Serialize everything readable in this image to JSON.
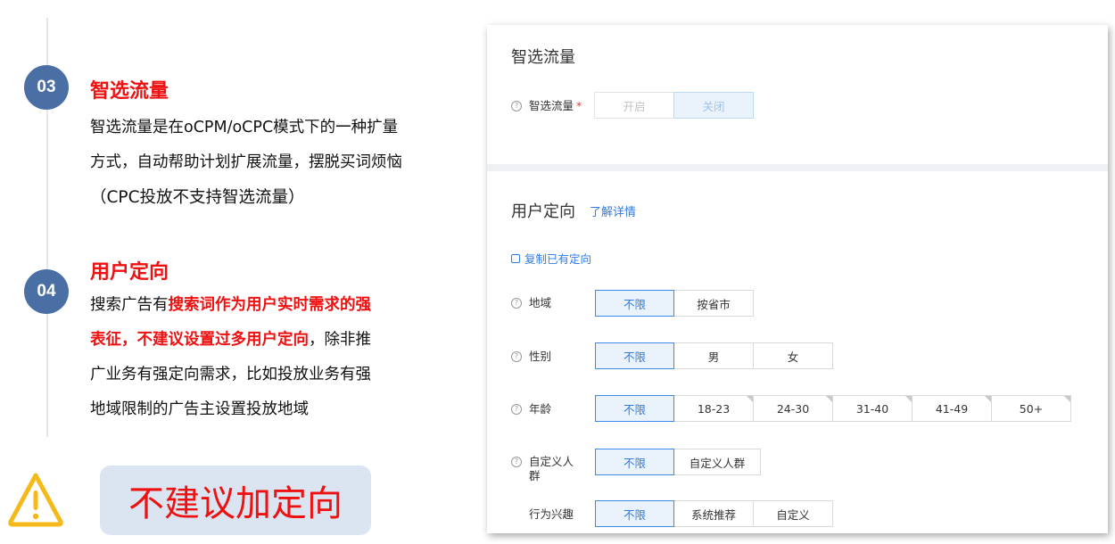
{
  "steps": [
    {
      "number": "03",
      "title": "智选流量",
      "lines": [
        "智选流量是在oCPM/oCPC模式下的一种扩量",
        "方式，自动帮助计划扩展流量，摆脱买词烦恼",
        "（CPC投放不支持智选流量）"
      ]
    },
    {
      "number": "04",
      "title": "用户定向",
      "body_prefix": "搜索广告有",
      "body_highlight_1": "搜索词作为用户实时需求的强",
      "body_highlight_2": "表征，不建议设置过多用户定向",
      "body_suffix": "，除非推",
      "lines": [
        "广业务有强定向需求，比如投放业务有强",
        "地域限制的广告主设置投放地域"
      ]
    }
  ],
  "warning": {
    "icon": "warning-triangle-icon",
    "text": "不建议加定向"
  },
  "panel": {
    "smart_traffic": {
      "title": "智选流量",
      "field_label": "智选流量",
      "required_mark": "*",
      "options": [
        "开启",
        "关闭"
      ],
      "selected": "关闭"
    },
    "user_targeting": {
      "title": "用户定向",
      "learn_more": "了解详情",
      "copy_link": "复制已有定向",
      "rows": [
        {
          "label": "地域",
          "options": [
            "不限",
            "按省市"
          ],
          "selected": "不限"
        },
        {
          "label": "性别",
          "options": [
            "不限",
            "男",
            "女"
          ],
          "selected": "不限"
        },
        {
          "label": "年龄",
          "options": [
            "不限",
            "18-23",
            "24-30",
            "31-40",
            "41-49",
            "50+"
          ],
          "selected": "不限"
        },
        {
          "label_line1": "自定义人",
          "label_line2": "群",
          "options": [
            "不限",
            "自定义人群"
          ],
          "selected": "不限"
        },
        {
          "label": "行为兴趣",
          "options": [
            "不限",
            "系统推荐",
            "自定义"
          ],
          "selected": "不限"
        }
      ]
    },
    "help_glyph": "?"
  },
  "colors": {
    "accent_red": "#ee1111",
    "badge_blue": "#4a6fa5",
    "link_blue": "#2f7ae5",
    "warn_box_bg": "#dbe5f1",
    "warn_yellow": "#f6b91a"
  }
}
